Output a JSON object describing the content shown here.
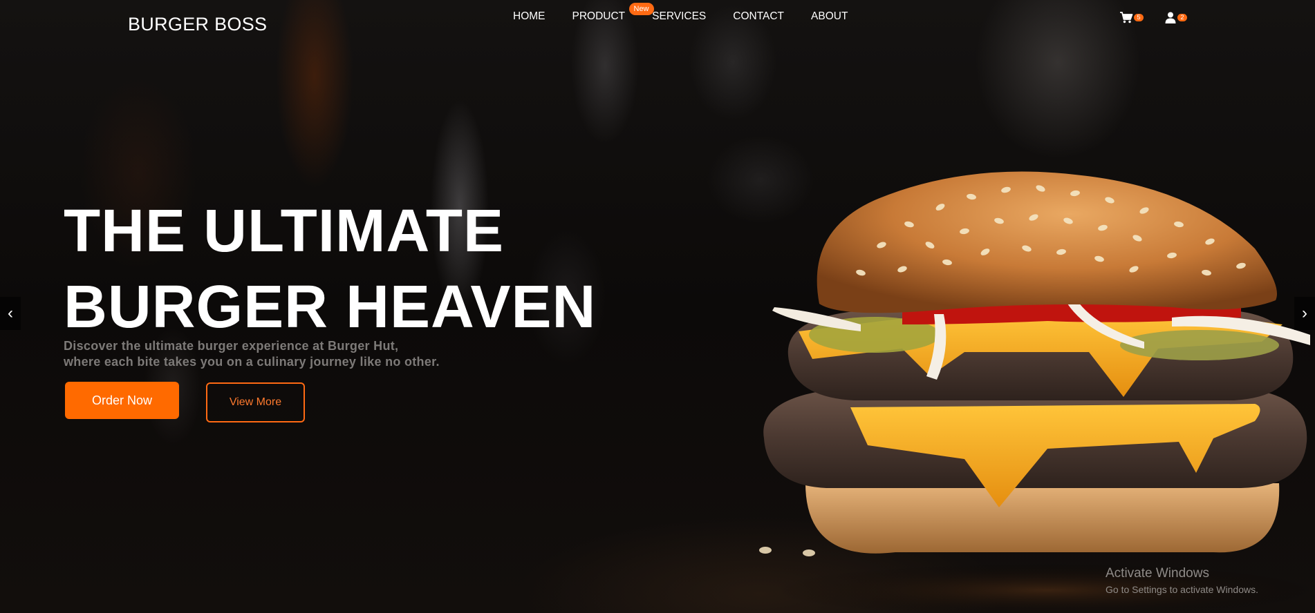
{
  "brand": {
    "name": "BURGER BOSS"
  },
  "nav": {
    "items": [
      {
        "label": "HOME"
      },
      {
        "label": "PRODUCT",
        "badge": "New"
      },
      {
        "label": "SERVICES"
      },
      {
        "label": "CONTACT"
      },
      {
        "label": "ABOUT"
      }
    ]
  },
  "header_icons": {
    "cart": {
      "icon": "cart-icon",
      "count": "5"
    },
    "user": {
      "icon": "user-icon",
      "count": "2"
    }
  },
  "hero": {
    "title_line1": "THE ULTIMATE",
    "title_line2": "BURGER HEAVEN",
    "desc_line1": "Discover the ultimate burger experience at Burger Hut,",
    "desc_line2": "where each bite takes you on a culinary journey like no other.",
    "primary_button": "Order Now",
    "secondary_button": "View More"
  },
  "carousel": {
    "prev_label": "‹",
    "next_label": "›"
  },
  "watermark": {
    "title": "Activate Windows",
    "subtitle": "Go to Settings to activate Windows."
  },
  "colors": {
    "accent": "#ff6a00",
    "background": "#0b0908"
  }
}
